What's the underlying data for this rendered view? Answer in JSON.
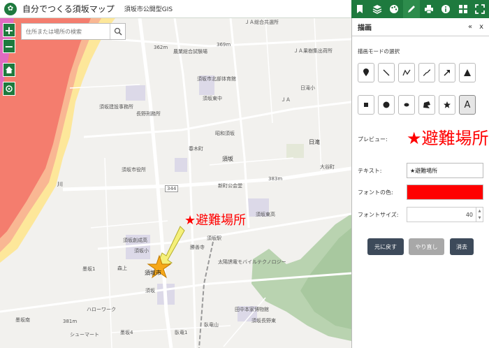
{
  "header": {
    "title": "自分でつくる須坂マップ",
    "subtitle": "須坂市公開型GIS"
  },
  "search": {
    "placeholder": "住所または場所の検索"
  },
  "map_controls": {
    "zoom_in": "+",
    "zoom_out": "−"
  },
  "map_labels": [
    "ＪＡ総合共選所",
    "362m",
    "農業総合試験場",
    "369m",
    "ＪＡ果樹集出荷所",
    "須坂市北部体育館",
    "日滝小",
    "須坂東中",
    "ＪＡ",
    "須坂建設事務所",
    "長野刑務所",
    "昭和須坂",
    "春木町",
    "須坂",
    "日滝",
    "大谷町",
    "須坂市役所",
    "新町公会堂",
    "383m",
    "須坂東高",
    "須坂創成高",
    "須坂小",
    "勝善寺",
    "須坂駅",
    "太陽誘電モバイルテクノロジー",
    "須坂",
    "ハローワーク",
    "田中本家博物館",
    "381m",
    "須坂長野東",
    "シューマート",
    "臥竜山",
    "墨坂南",
    "墨坂4",
    "臥竜1",
    "森上",
    "墨坂1",
    "川",
    "344",
    "須坂市"
  ],
  "placed_text": "★避難場所",
  "toolbar": {
    "tools": [
      "bookmark-icon",
      "layers-icon",
      "palette-icon",
      "pencil-icon",
      "printer-icon",
      "info-icon",
      "grid-icon",
      "fullscreen-icon"
    ],
    "active": "pencil-icon"
  },
  "panel": {
    "title": "描画",
    "collapse": "«",
    "close": "x",
    "mode_label": "描画モードの選択",
    "modes": [
      "point",
      "line",
      "polyline",
      "freehand-line",
      "arrow",
      "triangle",
      "rectangle",
      "circle",
      "ellipse",
      "freehand-polygon",
      "star",
      "text"
    ],
    "text_mode_glyph": "A",
    "preview_label": "プレビュー:",
    "preview_text": "★避難場所",
    "text_label": "テキスト:",
    "text_value": "★避難場所",
    "font_color_label": "フォントの色:",
    "font_color": "#ff0000",
    "font_size_label": "フォントサイズ:",
    "font_size": "40",
    "undo": "元に戻す",
    "redo": "やり直し",
    "erase": "消去"
  },
  "colors": {
    "brand_green": "#1e7a3e",
    "button_dark": "#3d4a5a",
    "button_disabled": "#a8a8a8",
    "text_red": "#ff0000"
  }
}
